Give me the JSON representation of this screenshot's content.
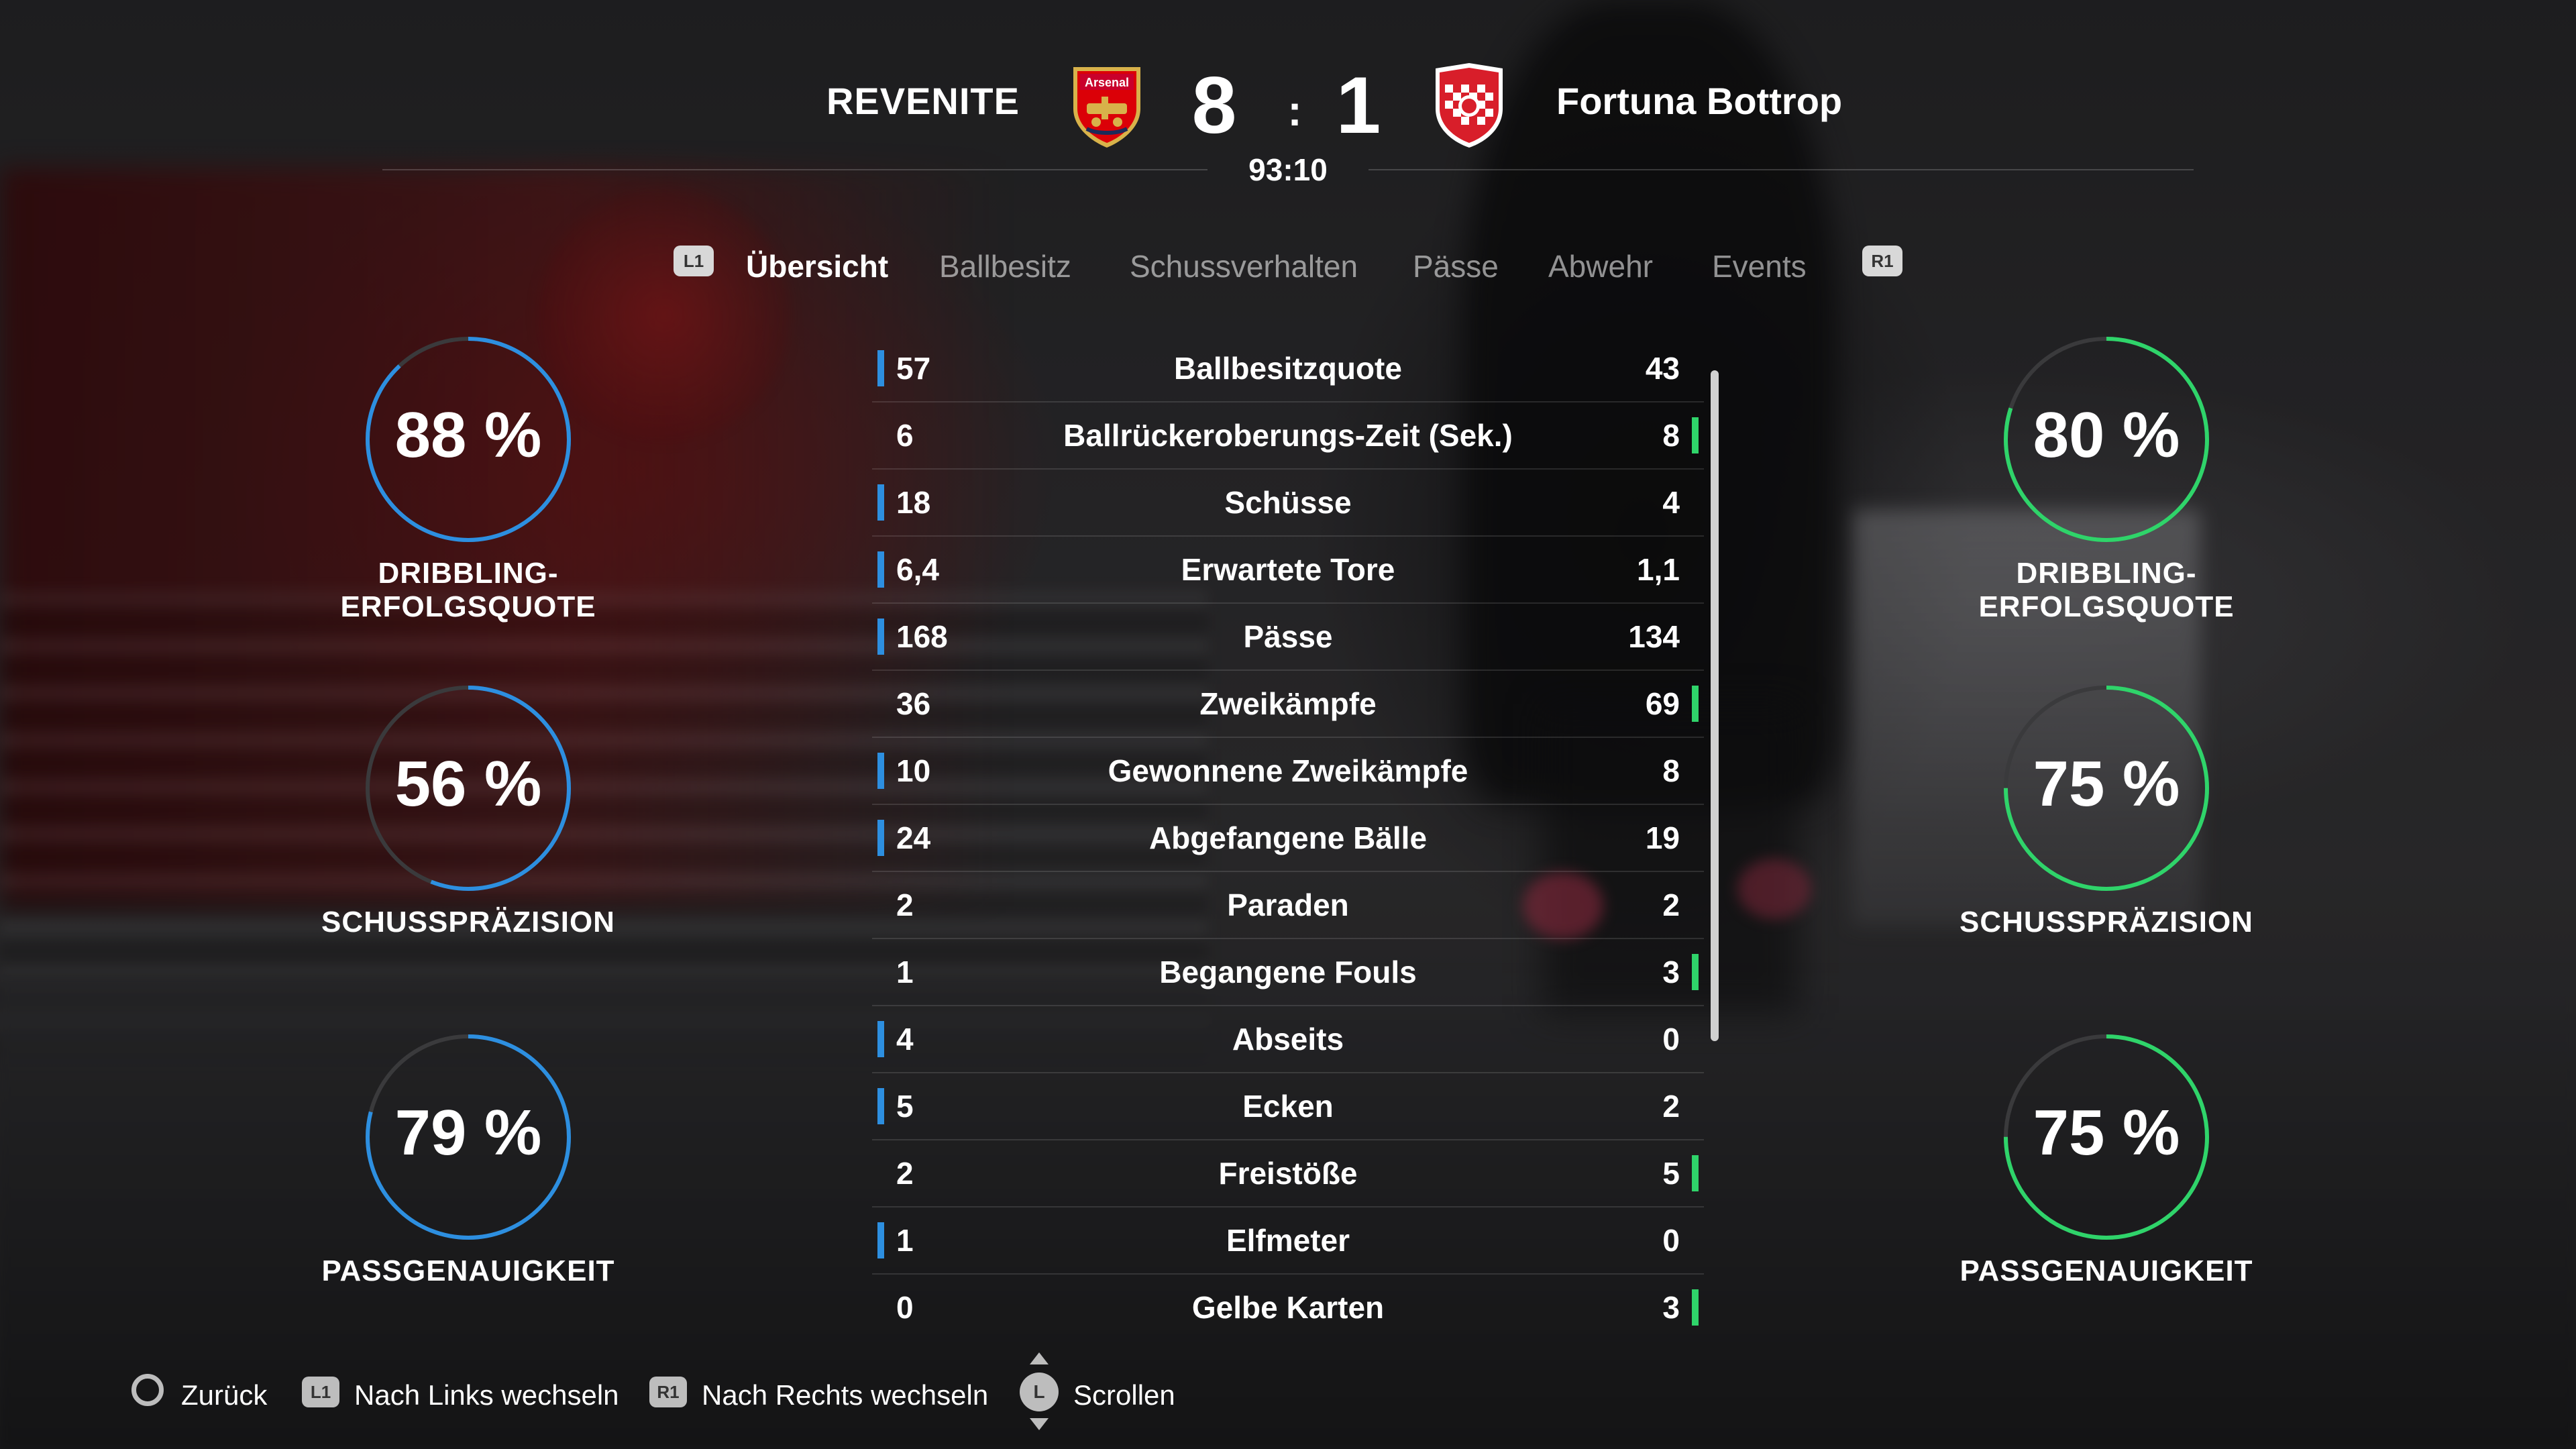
{
  "match": {
    "home_team": "REVENITE",
    "away_team": "Fortuna Bottrop",
    "home_score": "8",
    "away_score": "1",
    "score_separator": ":",
    "time": "93:10",
    "home_crest_text": "Arsenal",
    "home_crest": "arsenal-crest-icon",
    "away_crest": "fortuna-bottrop-crest-icon"
  },
  "tabs": {
    "prev_button": "L1",
    "next_button": "R1",
    "items": [
      {
        "label": "Übersicht",
        "active": true
      },
      {
        "label": "Ballbesitz",
        "active": false
      },
      {
        "label": "Schussverhalten",
        "active": false
      },
      {
        "label": "Pässe",
        "active": false
      },
      {
        "label": "Abwehr",
        "active": false
      },
      {
        "label": "Events",
        "active": false
      }
    ]
  },
  "rings": {
    "home": [
      {
        "value": "88 %",
        "percent": 88,
        "label": "DRIBBLING-ERFOLGSQUOTE"
      },
      {
        "value": "56 %",
        "percent": 56,
        "label": "SCHUSSPRÄZISION"
      },
      {
        "value": "79 %",
        "percent": 79,
        "label": "PASSGENAUIGKEIT"
      }
    ],
    "away": [
      {
        "value": "80 %",
        "percent": 80,
        "label": "DRIBBLING-ERFOLGSQUOTE"
      },
      {
        "value": "75 %",
        "percent": 75,
        "label": "SCHUSSPRÄZISION"
      },
      {
        "value": "75 %",
        "percent": 75,
        "label": "PASSGENAUIGKEIT"
      }
    ]
  },
  "stats": [
    {
      "name": "Ballbesitzquote",
      "home": "57",
      "away": "43",
      "leader": "home"
    },
    {
      "name": "Ballrückeroberungs-Zeit (Sek.)",
      "home": "6",
      "away": "8",
      "leader": "away"
    },
    {
      "name": "Schüsse",
      "home": "18",
      "away": "4",
      "leader": "home"
    },
    {
      "name": "Erwartete Tore",
      "home": "6,4",
      "away": "1,1",
      "leader": "home"
    },
    {
      "name": "Pässe",
      "home": "168",
      "away": "134",
      "leader": "home"
    },
    {
      "name": "Zweikämpfe",
      "home": "36",
      "away": "69",
      "leader": "away"
    },
    {
      "name": "Gewonnene Zweikämpfe",
      "home": "10",
      "away": "8",
      "leader": "home"
    },
    {
      "name": "Abgefangene Bälle",
      "home": "24",
      "away": "19",
      "leader": "home"
    },
    {
      "name": "Paraden",
      "home": "2",
      "away": "2",
      "leader": "none"
    },
    {
      "name": "Begangene Fouls",
      "home": "1",
      "away": "3",
      "leader": "away"
    },
    {
      "name": "Abseits",
      "home": "4",
      "away": "0",
      "leader": "home"
    },
    {
      "name": "Ecken",
      "home": "5",
      "away": "2",
      "leader": "home"
    },
    {
      "name": "Freistöße",
      "home": "2",
      "away": "5",
      "leader": "away"
    },
    {
      "name": "Elfmeter",
      "home": "1",
      "away": "0",
      "leader": "home"
    },
    {
      "name": "Gelbe Karten",
      "home": "0",
      "away": "3",
      "leader": "away"
    }
  ],
  "footer": {
    "back": "Zurück",
    "prev": "Nach Links wechseln",
    "prev_button": "L1",
    "next": "Nach Rechts wechseln",
    "next_button": "R1",
    "scroll": "Scrollen",
    "scroll_button": "L"
  },
  "colors": {
    "home": "#2d8fe0",
    "away": "#2fd46a",
    "ring_track": "#3a3a3c"
  }
}
